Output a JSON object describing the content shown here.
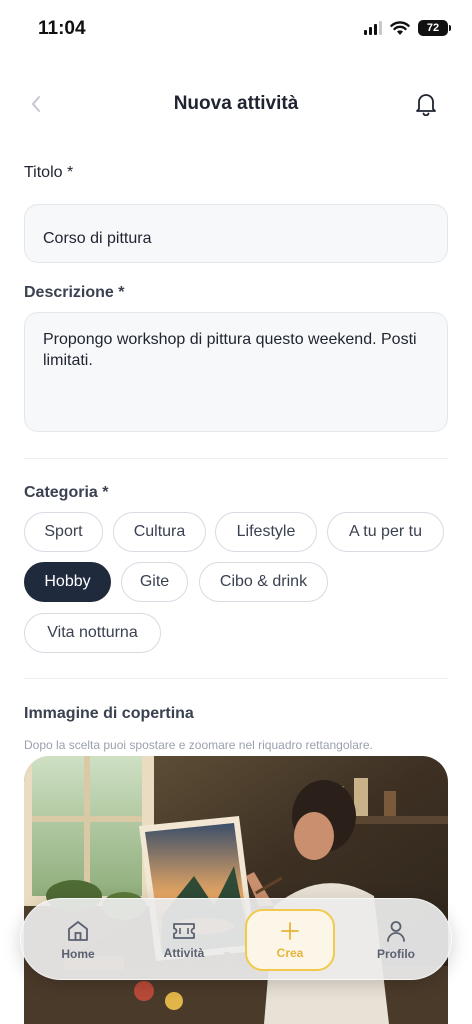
{
  "status": {
    "time": "11:04",
    "battery": "72"
  },
  "header": {
    "title": "Nuova attività"
  },
  "form": {
    "title_label": "Titolo *",
    "title_value": "Corso di pittura",
    "description_label": "Descrizione *",
    "description_value": "Propongo workshop di pittura questo weekend. Posti limitati.",
    "category_label": "Categoria *",
    "categories": [
      {
        "label": "Sport",
        "selected": false
      },
      {
        "label": "Cultura",
        "selected": false
      },
      {
        "label": "Lifestyle",
        "selected": false
      },
      {
        "label": "A tu per tu",
        "selected": false
      },
      {
        "label": "Hobby",
        "selected": true
      },
      {
        "label": "Gite",
        "selected": false
      },
      {
        "label": "Cibo & drink",
        "selected": false
      },
      {
        "label": "Vita notturna",
        "selected": false
      }
    ],
    "cover_label": "Immagine di copertina",
    "cover_hint": "Dopo la scelta puoi spostare e zoomare nel riquadro rettangolare."
  },
  "tabbar": {
    "items": [
      {
        "label": "Home",
        "icon": "home-icon"
      },
      {
        "label": "Attività",
        "icon": "ticket-icon"
      },
      {
        "label": "Crea",
        "icon": "plus-icon",
        "active": true
      },
      {
        "label": "Profilo",
        "icon": "user-icon"
      }
    ]
  },
  "colors": {
    "accent": "#f2c94c",
    "selected_chip": "#1f2a3c"
  }
}
